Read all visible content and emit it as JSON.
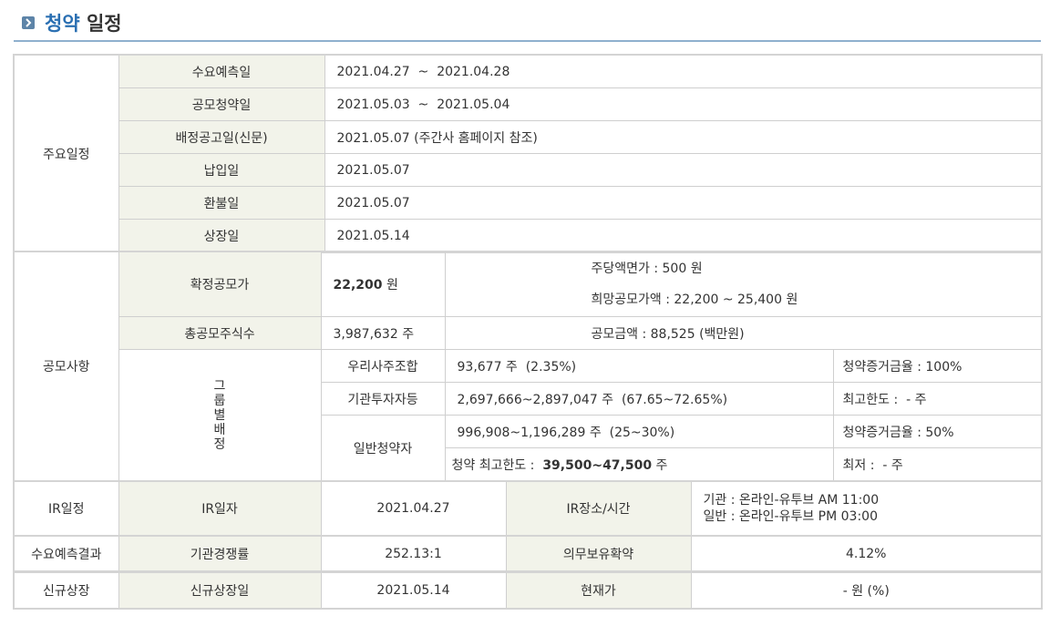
{
  "header": {
    "title_highlight": "청약",
    "title_rest": " 일정"
  },
  "schedule": {
    "category": "주요일정",
    "rows": [
      {
        "label": "수요예측일",
        "value": "2021.04.27  ~  2021.04.28"
      },
      {
        "label": "공모청약일",
        "value": "2021.05.03  ~  2021.05.04"
      },
      {
        "label": "배정공고일(신문)",
        "value": "2021.05.07 (주간사 홈페이지 참조)"
      },
      {
        "label": "납입일",
        "value": "2021.05.07"
      },
      {
        "label": "환불일",
        "value": "2021.05.07"
      },
      {
        "label": "상장일",
        "value": "2021.05.14"
      }
    ]
  },
  "offering": {
    "category": "공모사항",
    "confirmed_price_label": "확정공모가",
    "confirmed_price_value": "22,200",
    "confirmed_price_unit": " 원",
    "par_value": "주당액면가 :  500 원",
    "desired_price": "희망공모가액 :  22,200 ~ 25,400 원",
    "total_shares_label": "총공모주식수",
    "total_shares_value": "3,987,632 주",
    "amount": "공모금액 : 88,525 (백만원)",
    "group_label": [
      "그",
      "룹",
      "별",
      "배",
      "정"
    ],
    "group": {
      "employee_label": "우리사주조합",
      "employee_value": "93,677 주  (2.35%)",
      "employee_note": "청약증거금율 : 100%",
      "institution_label": "기관투자자등",
      "institution_value": "2,697,666~2,897,047 주  (67.65~72.65%)",
      "institution_note": "최고한도 :  - 주",
      "retail_label": "일반청약자",
      "retail_value": "996,908~1,196,289 주  (25~30%)",
      "retail_note": "청약증거금율 : 50%",
      "retail_limit_prefix": "청약 최고한도 :  ",
      "retail_limit_value": "39,500~47,500",
      "retail_limit_unit": " 주",
      "retail_min": "최저 :  - 주"
    }
  },
  "ir": {
    "category": "IR일정",
    "date_label": "IR일자",
    "date_value": "2021.04.27",
    "place_label": "IR장소/시간",
    "place_line1": "기관 : 온라인-유투브 AM 11:00",
    "place_line2": "일반 : 온라인-유투브 PM 03:00"
  },
  "demand": {
    "category": "수요예측결과",
    "competition_label": "기관경쟁률",
    "competition_value": "252.13:1",
    "lockup_label": "의무보유확약",
    "lockup_value": "4.12%"
  },
  "listing": {
    "category": "신규상장",
    "date_label": "신규상장일",
    "date_value": "2021.05.14",
    "price_label": "현재가",
    "price_value": "- 원 (%)"
  }
}
